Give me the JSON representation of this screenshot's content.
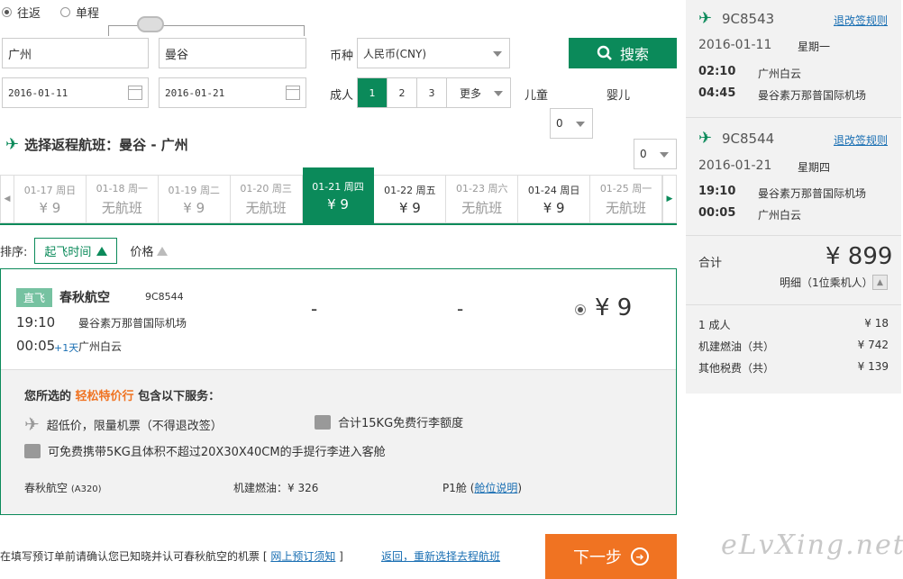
{
  "search": {
    "trip_round": "往返",
    "trip_oneway": "单程",
    "from_city": "广州",
    "to_city": "曼谷",
    "depart_date": "2016-01-11",
    "return_date": "2016-01-21",
    "currency_label": "币种",
    "currency_value": "人民币(CNY)",
    "search_button": "搜索",
    "adult_label": "成人",
    "adult_options": [
      "1",
      "2",
      "3"
    ],
    "adult_more": "更多",
    "child_label": "儿童",
    "child_value": "0",
    "infant_label": "婴儿",
    "infant_value": "0"
  },
  "section_title": "选择返程航班：曼谷 - 广州",
  "date_tabs": [
    {
      "date": "01-17",
      "weekday": "周日",
      "price": "¥ 9",
      "has": false
    },
    {
      "date": "01-18",
      "weekday": "周一",
      "price": "无航班",
      "has": false
    },
    {
      "date": "01-19",
      "weekday": "周二",
      "price": "¥ 9",
      "has": false
    },
    {
      "date": "01-20",
      "weekday": "周三",
      "price": "无航班",
      "has": false
    },
    {
      "date": "01-21",
      "weekday": "周四",
      "price": "¥ 9",
      "has": true,
      "active": true
    },
    {
      "date": "01-22",
      "weekday": "周五",
      "price": "¥ 9",
      "has": true
    },
    {
      "date": "01-23",
      "weekday": "周六",
      "price": "无航班",
      "has": false
    },
    {
      "date": "01-24",
      "weekday": "周日",
      "price": "¥ 9",
      "has": true
    },
    {
      "date": "01-25",
      "weekday": "周一",
      "price": "无航班",
      "has": false
    }
  ],
  "sort": {
    "label": "排序:",
    "by_time": "起飞时间",
    "by_price": "价格"
  },
  "flight": {
    "badge": "直飞",
    "airline": "春秋航空",
    "flight_no": "9C8544",
    "dep_time": "19:10",
    "dep_airport": "曼谷素万那普国际机场",
    "arr_time": "00:05",
    "arr_plus": "+1天",
    "arr_airport": "广州白云",
    "dash1": "-",
    "dash2": "-",
    "price": "¥ 9",
    "services_prefix": "您所选的",
    "services_name": "轻松特价行",
    "services_suffix": "包含以下服务：",
    "svc1": "超低价，限量机票（不得退改签）",
    "svc2": "合计15KG免费行李额度",
    "svc3": "可免费携带5KG且体积不超过20X30X40CM的手提行李进入客舱",
    "aircraft_airline": "春秋航空",
    "aircraft": "(A320)",
    "fuel": "机建燃油：¥ 326",
    "cabin": "P1舱",
    "cabin_link": "舱位说明"
  },
  "summary": {
    "leg1": {
      "flight_no": "9C8543",
      "rules_link": "退改签规则",
      "date": "2016-01-11",
      "weekday": "星期一",
      "dep_time": "02:10",
      "dep_airport": "广州白云",
      "arr_time": "04:45",
      "arr_airport": "曼谷素万那普国际机场"
    },
    "leg2": {
      "flight_no": "9C8544",
      "rules_link": "退改签规则",
      "date": "2016-01-21",
      "weekday": "星期四",
      "dep_time": "19:10",
      "dep_airport": "曼谷素万那普国际机场",
      "arr_time": "00:05",
      "arr_airport": "广州白云"
    },
    "total_label": "合计",
    "total_value": "¥ 899",
    "detail_label": "明细（1位乘机人）",
    "rows": [
      {
        "label": "1 成人",
        "value": "¥ 18"
      },
      {
        "label": "机建燃油（共）",
        "value": "¥ 742"
      },
      {
        "label": "其他税费（共）",
        "value": "¥ 139"
      }
    ]
  },
  "footer": {
    "notice": "在填写预订单前请确认您已知晓并认可春秋航空的机票 [",
    "notice_link": "网上预订须知",
    "notice_end": "]",
    "back_link": "返回，重新选择去程航班",
    "next_button": "下一步"
  },
  "watermark": "eLvXing.net"
}
